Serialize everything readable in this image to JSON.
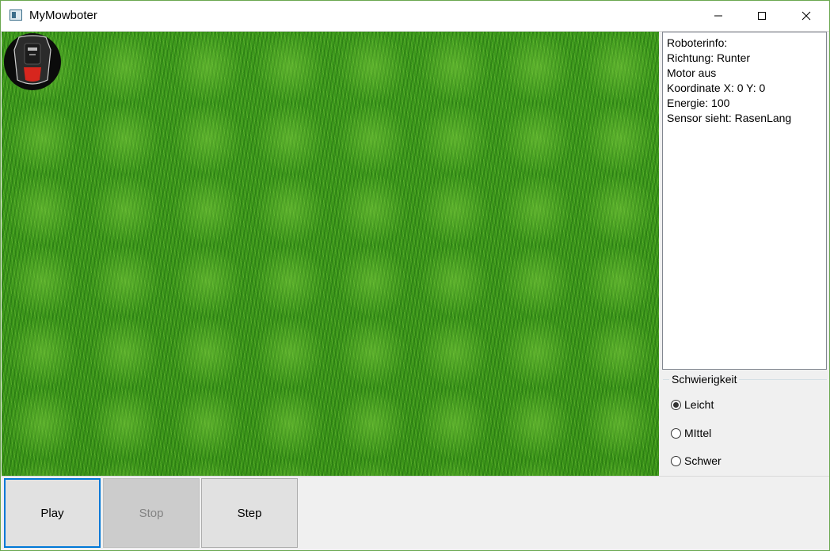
{
  "window": {
    "title": "MyMowboter"
  },
  "icons": {
    "app": "app-window-icon",
    "minimize": "minimize-icon",
    "maximize": "maximize-icon",
    "close": "close-icon",
    "robot": "robot-mower-icon"
  },
  "info": {
    "lines": [
      "Roboterinfo:",
      "Richtung: Runter",
      "Motor aus",
      "Koordinate X: 0 Y: 0",
      "Energie: 100",
      "Sensor sieht: RasenLang"
    ]
  },
  "difficulty": {
    "title": "Schwierigkeit",
    "options": [
      "Leicht",
      "MIttel",
      "Schwer"
    ],
    "selected": "Leicht"
  },
  "buttons": {
    "play": "Play",
    "stop": "Stop",
    "step": "Step"
  },
  "colors": {
    "accent": "#0078d7",
    "lawn": "#3f9a1e",
    "robot_light": "#d7261e"
  }
}
